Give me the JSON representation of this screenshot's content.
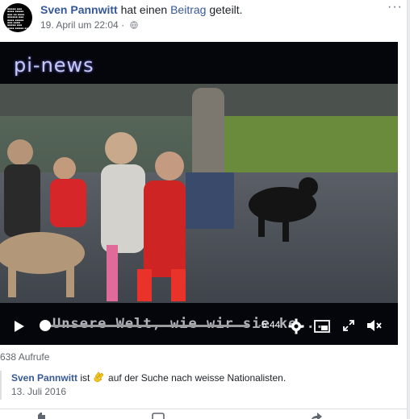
{
  "post": {
    "author": "Sven Pannwitt",
    "action_text": "hat einen",
    "link_text": "Beitrag",
    "action_suffix": "geteilt.",
    "date": "19. April um 22:04",
    "privacy_icon": "globe-icon",
    "more_label": "···"
  },
  "video": {
    "brand_text": "pi-news",
    "subtitle_text": "Unsere Welt, wie wir sie ke...",
    "time_remaining": "-5:44",
    "progress_percent": 1
  },
  "stats": {
    "views": "638 Aufrufe"
  },
  "shared_post": {
    "author": "Sven Pannwitt",
    "verb": "ist",
    "emoji_icon": "clap-hands-icon",
    "status_text": "auf der Suche nach weisse Nationalisten.",
    "date": "13. Juli 2016"
  },
  "colors": {
    "link": "#365899",
    "meta": "#616770",
    "video_bg": "#05050c"
  }
}
